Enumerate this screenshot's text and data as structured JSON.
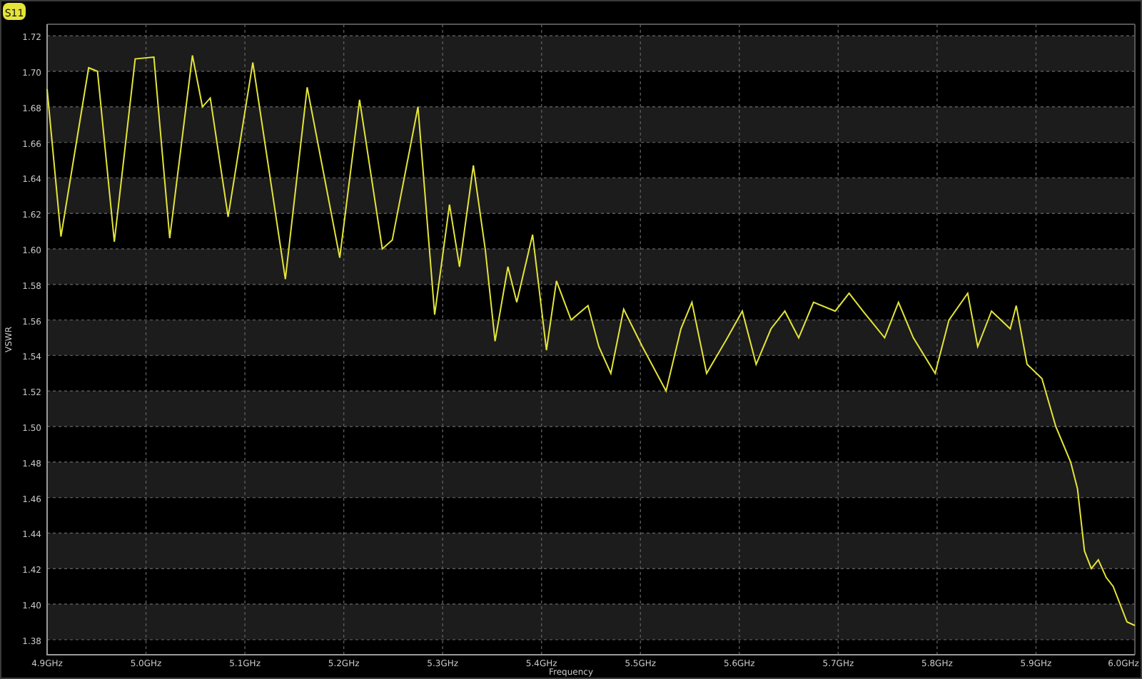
{
  "chart_data": {
    "type": "line",
    "grid": true,
    "xlabel": "Frequency",
    "ylabel": "VSWR",
    "xlim": [
      4.9,
      6.0
    ],
    "ylim": [
      1.3715,
      1.7265
    ],
    "xticks": [
      {
        "value": 4.9,
        "label": "4.9GHz"
      },
      {
        "value": 5.0,
        "label": "5.0GHz"
      },
      {
        "value": 5.1,
        "label": "5.1GHz"
      },
      {
        "value": 5.2,
        "label": "5.2GHz"
      },
      {
        "value": 5.3,
        "label": "5.3GHz"
      },
      {
        "value": 5.4,
        "label": "5.4GHz"
      },
      {
        "value": 5.5,
        "label": "5.5GHz"
      },
      {
        "value": 5.6,
        "label": "5.6GHz"
      },
      {
        "value": 5.7,
        "label": "5.7GHz"
      },
      {
        "value": 5.8,
        "label": "5.8GHz"
      },
      {
        "value": 5.9,
        "label": "5.9GHz"
      },
      {
        "value": 6.0,
        "label": "6.0GHz"
      }
    ],
    "yticks": [
      {
        "value": 1.38,
        "label": "1.38"
      },
      {
        "value": 1.4,
        "label": "1.40"
      },
      {
        "value": 1.42,
        "label": "1.42"
      },
      {
        "value": 1.44,
        "label": "1.44"
      },
      {
        "value": 1.46,
        "label": "1.46"
      },
      {
        "value": 1.48,
        "label": "1.48"
      },
      {
        "value": 1.5,
        "label": "1.50"
      },
      {
        "value": 1.52,
        "label": "1.52"
      },
      {
        "value": 1.54,
        "label": "1.54"
      },
      {
        "value": 1.56,
        "label": "1.56"
      },
      {
        "value": 1.58,
        "label": "1.58"
      },
      {
        "value": 1.6,
        "label": "1.60"
      },
      {
        "value": 1.62,
        "label": "1.62"
      },
      {
        "value": 1.64,
        "label": "1.64"
      },
      {
        "value": 1.66,
        "label": "1.66"
      },
      {
        "value": 1.68,
        "label": "1.68"
      },
      {
        "value": 1.7,
        "label": "1.70"
      },
      {
        "value": 1.72,
        "label": "1.72"
      }
    ],
    "x": [
      4.9,
      4.914,
      4.942,
      4.951,
      4.968,
      4.989,
      5.008,
      5.024,
      5.047,
      5.057,
      5.065,
      5.083,
      5.108,
      5.141,
      5.163,
      5.196,
      5.216,
      5.239,
      5.249,
      5.275,
      5.292,
      5.307,
      5.317,
      5.331,
      5.343,
      5.353,
      5.366,
      5.375,
      5.391,
      5.405,
      5.415,
      5.43,
      5.447,
      5.458,
      5.47,
      5.483,
      5.502,
      5.526,
      5.541,
      5.552,
      5.567,
      5.588,
      5.603,
      5.617,
      5.632,
      5.646,
      5.66,
      5.675,
      5.697,
      5.711,
      5.725,
      5.747,
      5.761,
      5.776,
      5.798,
      5.812,
      5.831,
      5.841,
      5.855,
      5.874,
      5.88,
      5.891,
      5.906,
      5.92,
      5.935,
      5.942,
      5.949,
      5.956,
      5.963,
      5.971,
      5.978,
      5.992,
      6.0
    ],
    "series": [
      {
        "name": "S11",
        "color": "#e4e43a",
        "values": [
          1.69,
          1.607,
          1.702,
          1.7,
          1.604,
          1.707,
          1.708,
          1.606,
          1.709,
          1.68,
          1.685,
          1.618,
          1.705,
          1.583,
          1.691,
          1.595,
          1.684,
          1.6,
          1.605,
          1.68,
          1.563,
          1.625,
          1.59,
          1.647,
          1.6,
          1.548,
          1.59,
          1.57,
          1.608,
          1.543,
          1.582,
          1.56,
          1.568,
          1.545,
          1.53,
          1.566,
          1.545,
          1.52,
          1.555,
          1.57,
          1.53,
          1.55,
          1.565,
          1.535,
          1.555,
          1.565,
          1.55,
          1.57,
          1.565,
          1.575,
          1.565,
          1.55,
          1.57,
          1.55,
          1.53,
          1.56,
          1.575,
          1.545,
          1.565,
          1.555,
          1.568,
          1.535,
          1.527,
          1.5,
          1.48,
          1.465,
          1.43,
          1.42,
          1.425,
          1.415,
          1.41,
          1.39,
          1.388
        ]
      }
    ]
  }
}
